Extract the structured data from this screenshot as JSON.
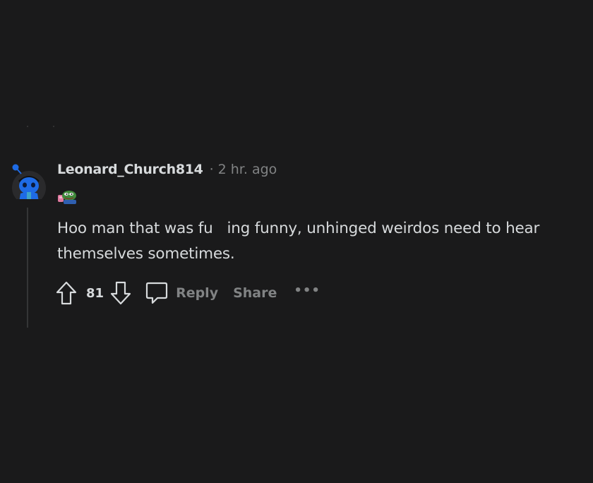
{
  "comment": {
    "username": "Leonard_Church814",
    "separator": "·",
    "time": "2 hr. ago",
    "body_line1": "Hoo man that was fu   ing funny, unhinged weirdos need to hear",
    "body_line2": "themselves sometimes.",
    "score": "81",
    "reply_label": "Reply",
    "share_label": "Share",
    "more_label": "•••",
    "icons": {
      "avatar": "snoo-avatar-icon",
      "flair": "pepe-flair-icon",
      "upvote": "upvote-arrow-icon",
      "downvote": "downvote-arrow-icon",
      "reply": "speech-bubble-icon"
    }
  },
  "colors": {
    "background": "#1a1a1b",
    "text": "#d7dadc",
    "muted": "#818384",
    "thread_line": "#343536",
    "avatar_blue": "#1e6be5"
  }
}
